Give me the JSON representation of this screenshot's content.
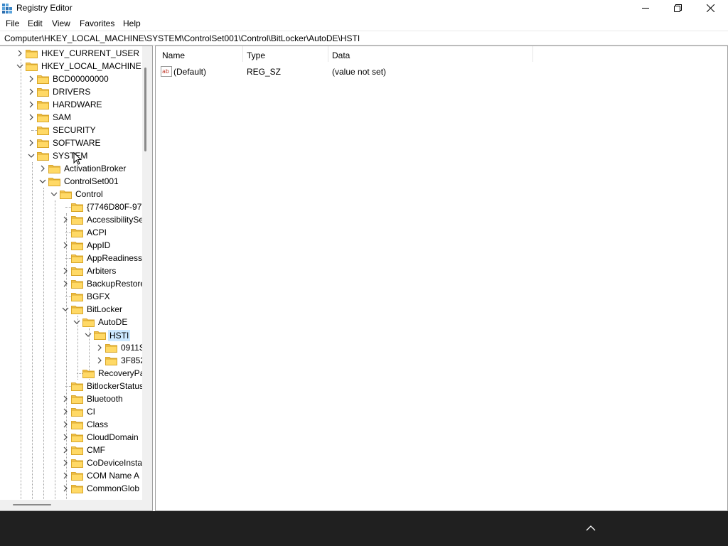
{
  "window": {
    "title": "Registry Editor"
  },
  "menu": [
    "File",
    "Edit",
    "View",
    "Favorites",
    "Help"
  ],
  "address": "Computer\\HKEY_LOCAL_MACHINE\\SYSTEM\\ControlSet001\\Control\\BitLocker\\AutoDE\\HSTI",
  "tree": [
    {
      "label": "HKEY_CURRENT_USER",
      "state": "collapsed"
    },
    {
      "label": "HKEY_LOCAL_MACHINE",
      "state": "expanded"
    },
    {
      "label": "BCD00000000",
      "state": "collapsed"
    },
    {
      "label": "DRIVERS",
      "state": "collapsed"
    },
    {
      "label": "HARDWARE",
      "state": "collapsed"
    },
    {
      "label": "SAM",
      "state": "collapsed"
    },
    {
      "label": "SECURITY",
      "state": "none"
    },
    {
      "label": "SOFTWARE",
      "state": "collapsed"
    },
    {
      "label": "SYSTEM",
      "state": "expanded"
    },
    {
      "label": "ActivationBroker",
      "state": "collapsed"
    },
    {
      "label": "ControlSet001",
      "state": "expanded"
    },
    {
      "label": "Control",
      "state": "expanded"
    },
    {
      "label": "{7746D80F-97E",
      "state": "none"
    },
    {
      "label": "AccessibilitySe",
      "state": "collapsed"
    },
    {
      "label": "ACPI",
      "state": "none"
    },
    {
      "label": "AppID",
      "state": "collapsed"
    },
    {
      "label": "AppReadiness",
      "state": "none"
    },
    {
      "label": "Arbiters",
      "state": "collapsed"
    },
    {
      "label": "BackupRestore",
      "state": "collapsed"
    },
    {
      "label": "BGFX",
      "state": "none"
    },
    {
      "label": "BitLocker",
      "state": "expanded"
    },
    {
      "label": "AutoDE",
      "state": "expanded"
    },
    {
      "label": "HSTI",
      "state": "expanded",
      "selected": true
    },
    {
      "label": "0911S",
      "state": "collapsed"
    },
    {
      "label": "3F852",
      "state": "collapsed"
    },
    {
      "label": "RecoveryPa",
      "state": "none"
    },
    {
      "label": "BitlockerStatus",
      "state": "none"
    },
    {
      "label": "Bluetooth",
      "state": "collapsed"
    },
    {
      "label": "CI",
      "state": "collapsed"
    },
    {
      "label": "Class",
      "state": "collapsed"
    },
    {
      "label": "CloudDomain",
      "state": "collapsed"
    },
    {
      "label": "CMF",
      "state": "collapsed"
    },
    {
      "label": "CoDeviceInsta",
      "state": "collapsed"
    },
    {
      "label": "COM Name A",
      "state": "collapsed"
    },
    {
      "label": "CommonGlob",
      "state": "collapsed"
    }
  ],
  "values": {
    "columns": [
      "Name",
      "Type",
      "Data"
    ],
    "rows": [
      {
        "name": "(Default)",
        "type": "REG_SZ",
        "data": "(value not set)",
        "icon": "string-value-icon"
      }
    ]
  },
  "taskbar": {
    "icon": "chevron-up-icon"
  }
}
